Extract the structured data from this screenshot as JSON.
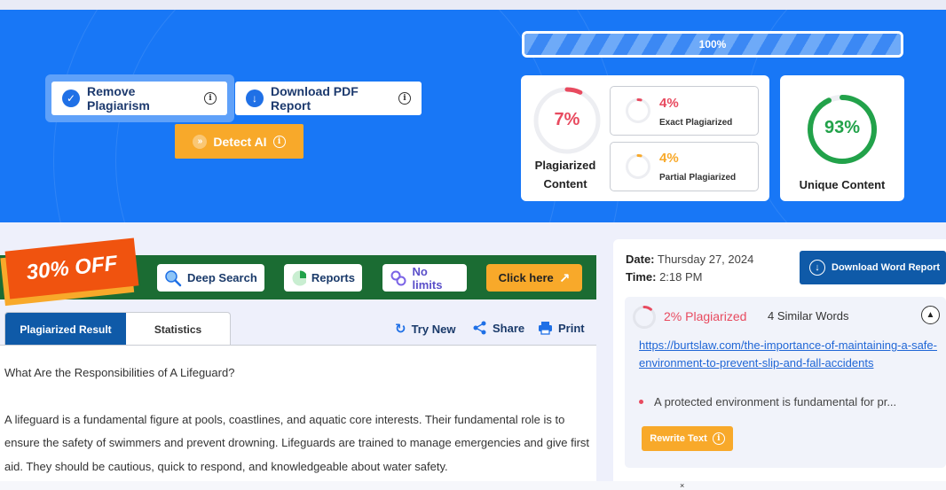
{
  "hero": {
    "remove_plagiarism_label": "Remove Plagiarism",
    "download_pdf_label": "Download PDF Report",
    "detect_ai_label": "Detect AI",
    "progress": {
      "percent": 1.0,
      "label": "100%"
    }
  },
  "plagiarism_card": {
    "percent_label": "7%",
    "percent_value": 0.07,
    "label_line1": "Plagiarized",
    "label_line2": "Content",
    "color": "#e84a5f"
  },
  "exact": {
    "percent_label": "4%",
    "percent_value": 0.04,
    "label": "Exact Plagiarized",
    "color": "#e84a5f"
  },
  "partial": {
    "percent_label": "4%",
    "percent_value": 0.04,
    "label": "Partial Plagiarized",
    "color": "#f8a92a"
  },
  "unique_card": {
    "percent_label": "93%",
    "percent_value": 0.93,
    "label": "Unique Content",
    "color": "#22a24a"
  },
  "promo": {
    "badge": "30% OFF",
    "deep_search": "Deep Search",
    "reports": "Reports",
    "no_limits": "No limits",
    "cta": "Click here"
  },
  "tabs": {
    "active": "Plagiarized Result",
    "other": "Statistics"
  },
  "actions": {
    "try_new": "Try New",
    "share": "Share",
    "print": "Print"
  },
  "content": {
    "title": "What Are the Responsibilities of A Lifeguard?",
    "paragraph": "A lifeguard is a fundamental figure at pools, coastlines, and aquatic core interests. Their fundamental role is to ensure the safety of swimmers and prevent drowning. Lifeguards are trained to manage emergencies and give first aid. They should be cautious, quick to respond, and knowledgeable about water safety."
  },
  "report_meta": {
    "date_label": "Date:",
    "date_value": "Thursday 27, 2024",
    "time_label": "Time:",
    "time_value": "2:18 PM",
    "download_word_label": "Download Word Report"
  },
  "result": {
    "percent_label": "2% Plagiarized",
    "similar_words": "4 Similar Words",
    "source_url": "https://burtslaw.com/the-importance-of-maintaining-a-safe-environment-to-prevent-slip-and-fall-accidents",
    "snippet": "A protected environment is fundamental for pr...",
    "rewrite_label": "Rewrite Text"
  },
  "colors": {
    "brand_blue": "#1877f6",
    "dark_blue": "#0f5aa8",
    "accent_orange": "#f8a92a",
    "promo_green": "#1b6c33",
    "alert_red": "#e84a5f"
  }
}
